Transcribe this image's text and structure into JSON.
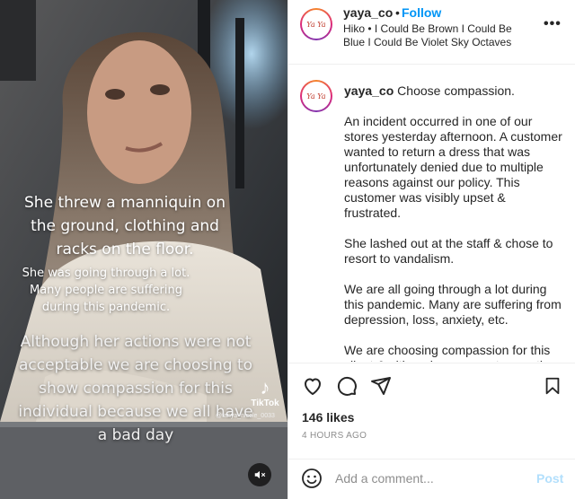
{
  "overlay": {
    "line1": "She threw a manniquin on the ground, clothing and racks on the floor.",
    "line2": "She was going through a lot. Many people are suffering during this pandemic.",
    "line3": "Although her actions were not acceptable we are choosing to show compassion for this individual because we all have a bad day",
    "tiktok_glyph": "♪",
    "tiktok_label": "TikTok",
    "tiktok_handle": "@tanya_nicole_0033"
  },
  "header": {
    "avatar_text": "Ya Ya",
    "username": "yaya_co",
    "separator": "•",
    "follow_label": "Follow",
    "audio": "Hiko • I Could Be Brown I Could Be Blue I Could Be Violet Sky Octaves",
    "more": "•••"
  },
  "caption": {
    "avatar_text": "Ya Ya",
    "username": "yaya_co",
    "first_line": "Choose compassion.",
    "paragraphs": [
      "An incident occurred in one of our stores yesterday afternoon. A customer wanted to return a dress that was unfortunately denied due to multiple reasons against our policy. This customer was visibly upset & frustrated.",
      "She lashed out at the staff & chose to resort to vandalism.",
      "We are all going through a lot during this pandemic. Many are suffering from depression, loss, anxiety, etc.",
      "We are choosing compassion for this client & although we are not accepting"
    ]
  },
  "engagement": {
    "likes": "146 likes",
    "time_ago": "4 HOURS AGO"
  },
  "comment": {
    "placeholder": "Add a comment...",
    "post_label": "Post"
  },
  "icons": {
    "like": "heart-icon",
    "comment": "comment-bubble-icon",
    "share": "paper-plane-icon",
    "save": "bookmark-icon",
    "emoji": "smiley-icon",
    "mute": "speaker-muted-icon",
    "more": "ellipsis-icon"
  },
  "colors": {
    "follow": "#0095f6",
    "post_disabled": "#b2dffc",
    "muted_text": "#8e8e8e",
    "primary_text": "#262626"
  }
}
